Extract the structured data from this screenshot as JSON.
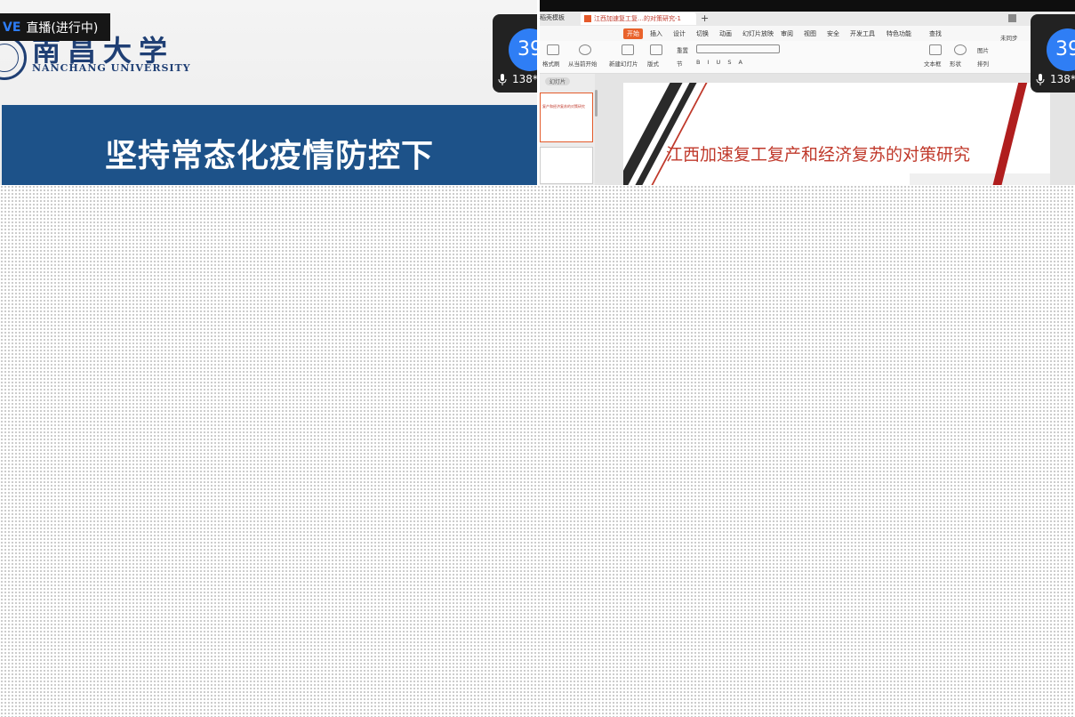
{
  "left_panel": {
    "live_tag": "VE",
    "live_status": "直播(进行中)",
    "university_cn": "南昌大学",
    "university_en": "NANCHANG UNIVERSITY",
    "banner_title": "坚持常态化疫情防控下",
    "participant_count": "138*",
    "avatar_text": "39"
  },
  "right_panel": {
    "tab_template": "稻壳模板",
    "tab_document": "江西加速复工复…的对策研究-1",
    "menu": [
      "开始",
      "插入",
      "设计",
      "切换",
      "动画",
      "幻灯片放映",
      "审阅",
      "视图",
      "安全",
      "开发工具",
      "特色功能",
      "查找"
    ],
    "ribbon": {
      "format_painter": "格式刷",
      "from_current": "从当前开始",
      "new_slide": "新建幻灯片",
      "layout": "版式",
      "section": "节",
      "reset": "重置",
      "textbox": "文本框",
      "shape": "形状",
      "arrange": "排列",
      "picture": "图片",
      "sync": "未同步"
    },
    "slides_label": "幻灯片",
    "slide_title": "江西加速复工复产和经济复苏的对策研究",
    "thumb_title": "复产和经济复苏的对策研究",
    "participant_count": "138*",
    "avatar_text": "39"
  },
  "colors": {
    "banner_blue": "#1d5289",
    "accent_orange": "#e9622b",
    "slide_red": "#c0392b",
    "avatar_blue": "#2f7ef5"
  }
}
